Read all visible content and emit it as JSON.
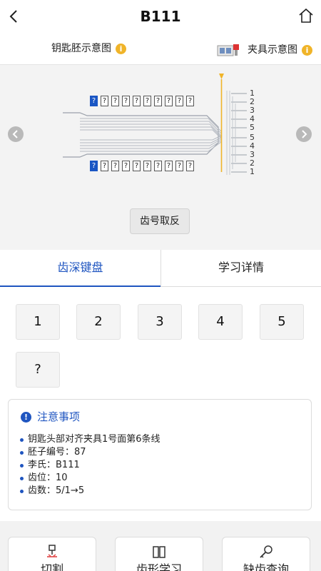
{
  "header": {
    "title": "B111",
    "back_icon": "back-chevron-icon",
    "home_icon": "home-icon"
  },
  "subheader": {
    "blank_diagram_label": "钥匙胚示意图",
    "clamp_diagram_label": "夹具示意图",
    "info_icon": "info-icon"
  },
  "diagram": {
    "top_row_cuts": [
      "?",
      "?",
      "?",
      "?",
      "?",
      "?",
      "?",
      "?",
      "?",
      "?"
    ],
    "bottom_row_cuts": [
      "?",
      "?",
      "?",
      "?",
      "?",
      "?",
      "?",
      "?",
      "?",
      "?"
    ],
    "top_depth_labels": [
      "1",
      "2",
      "3",
      "4",
      "5"
    ],
    "bottom_depth_labels": [
      "5",
      "4",
      "3",
      "2",
      "1"
    ],
    "invert_button": "齿号取反",
    "guide_color": "#f0b429",
    "active_cell_color": "#1a56c4"
  },
  "tabs": [
    {
      "label": "齿深键盘",
      "active": true
    },
    {
      "label": "学习详情",
      "active": false
    }
  ],
  "keypad": [
    "1",
    "2",
    "3",
    "4",
    "5",
    "?"
  ],
  "notice": {
    "title": "注意事项",
    "items": [
      "钥匙头部对齐夹具1号面第6条线",
      "胚子编号：87",
      "李氏：B111",
      "齿位：10",
      "齿数：5/1→5"
    ]
  },
  "bottom_buttons": [
    {
      "label": "切割",
      "icon": "cutter-icon"
    },
    {
      "label": "齿形学习",
      "icon": "book-icon"
    },
    {
      "label": "缺齿查询",
      "icon": "key-search-icon"
    }
  ],
  "colors": {
    "accent": "#1f55c0",
    "info": "#f0b429"
  }
}
